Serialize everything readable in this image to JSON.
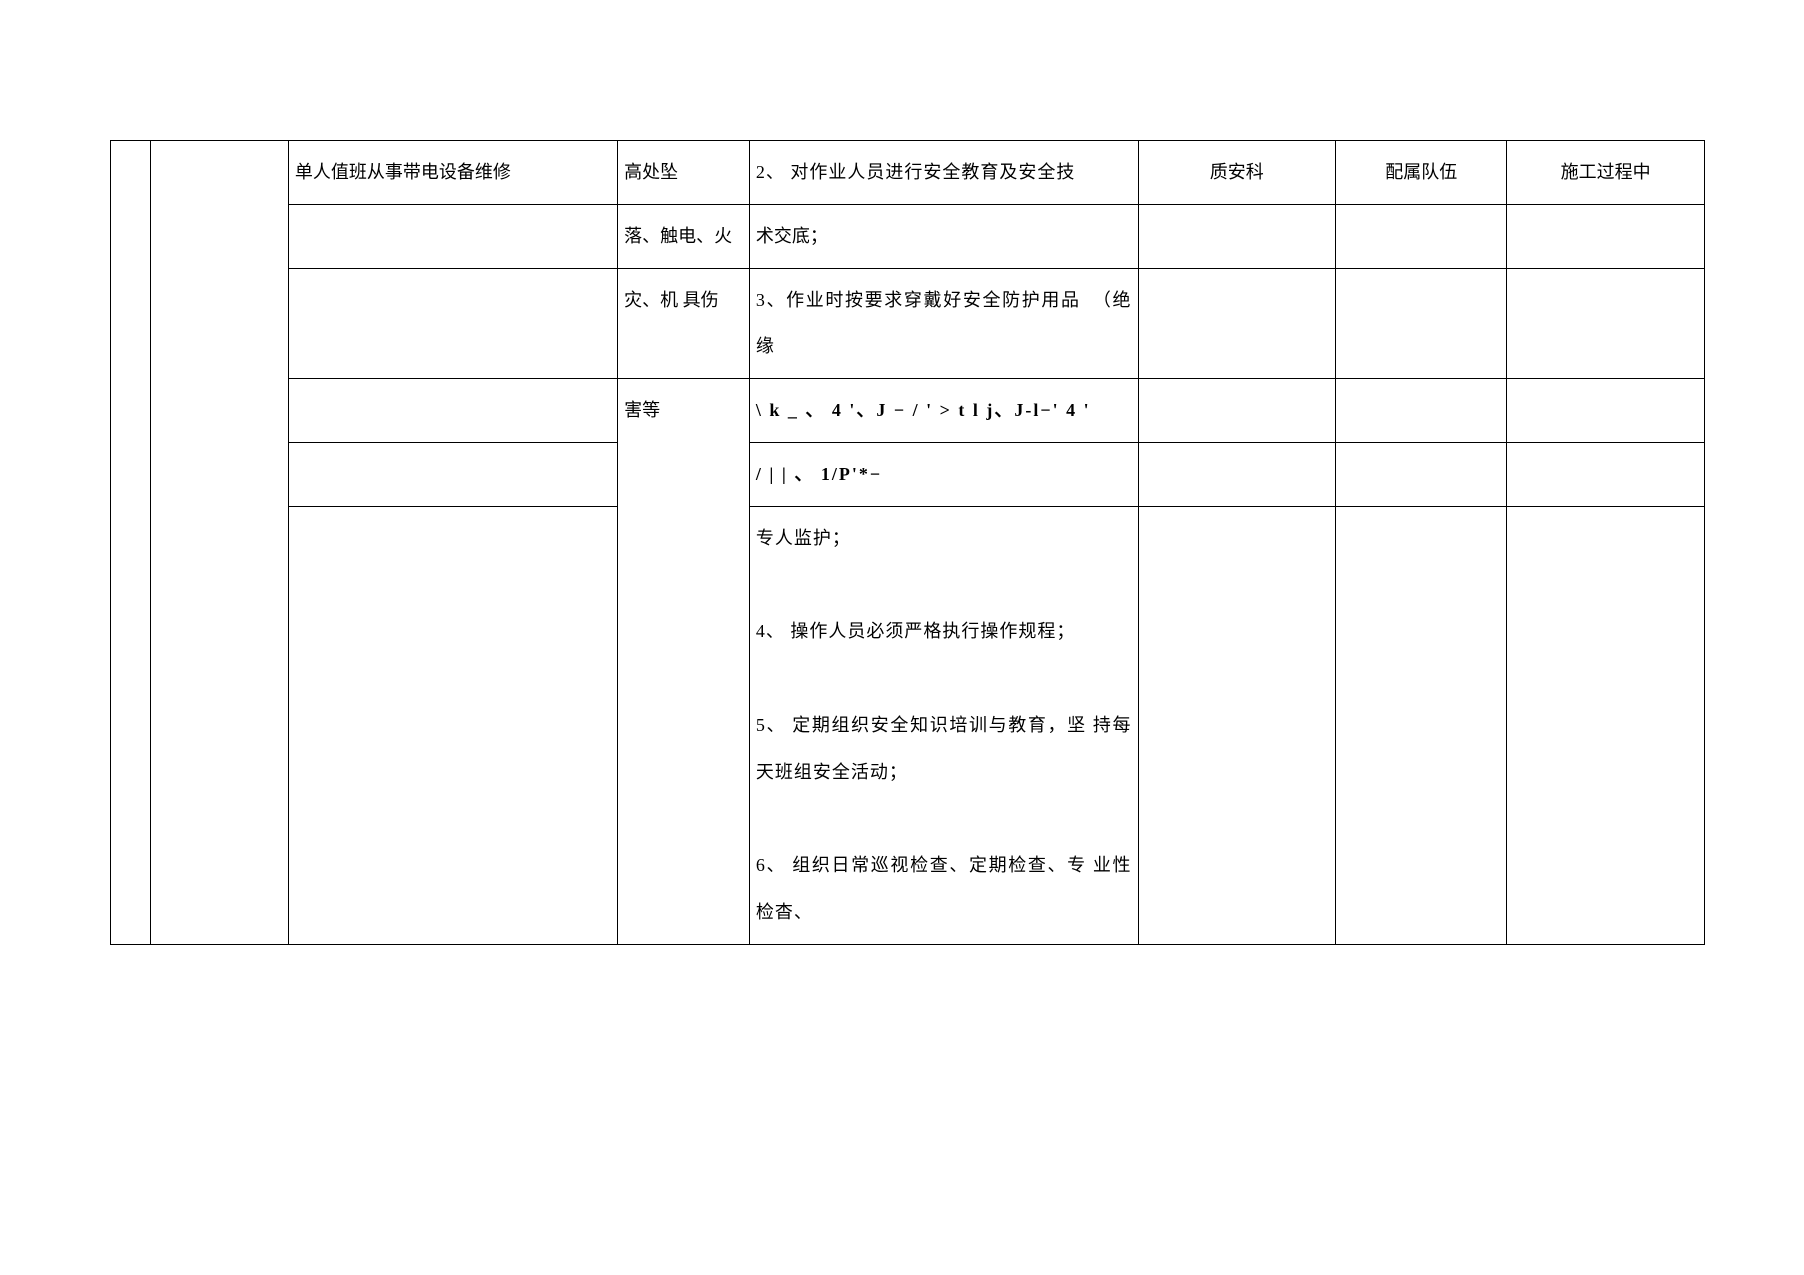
{
  "table": {
    "col_c_r1": "单人值班从事带电设备维修",
    "col_d_r1": "高处坠",
    "col_d_r2": "落、触电、火",
    "col_d_r3": "灾、机 具伤",
    "col_d_r4": "害等",
    "col_e_r1": "2、 对作业人员进行安全教育及安全技",
    "col_e_r2": "术交底；",
    "col_e_r3": "3、作业时按要求穿戴好安全防护用品  （绝缘",
    "col_e_r4": "\\ k _ 、 4 '、J − / ' > t l j、J-l−' 4 '",
    "col_e_r5": "/ | | 、 1/P'*−",
    "col_e_r6": "专人监护；\n\n4、 操作人员必须严格执行操作规程；\n\n5、 定期组织安全知识培训与教育，坚 持每天班组安全活动；\n\n6、 组织日常巡视检查、定期检查、专 业性检杳、",
    "col_f_r1": "质安科",
    "col_g_r1": "配属队伍",
    "col_h_r1": "施工过程中"
  }
}
